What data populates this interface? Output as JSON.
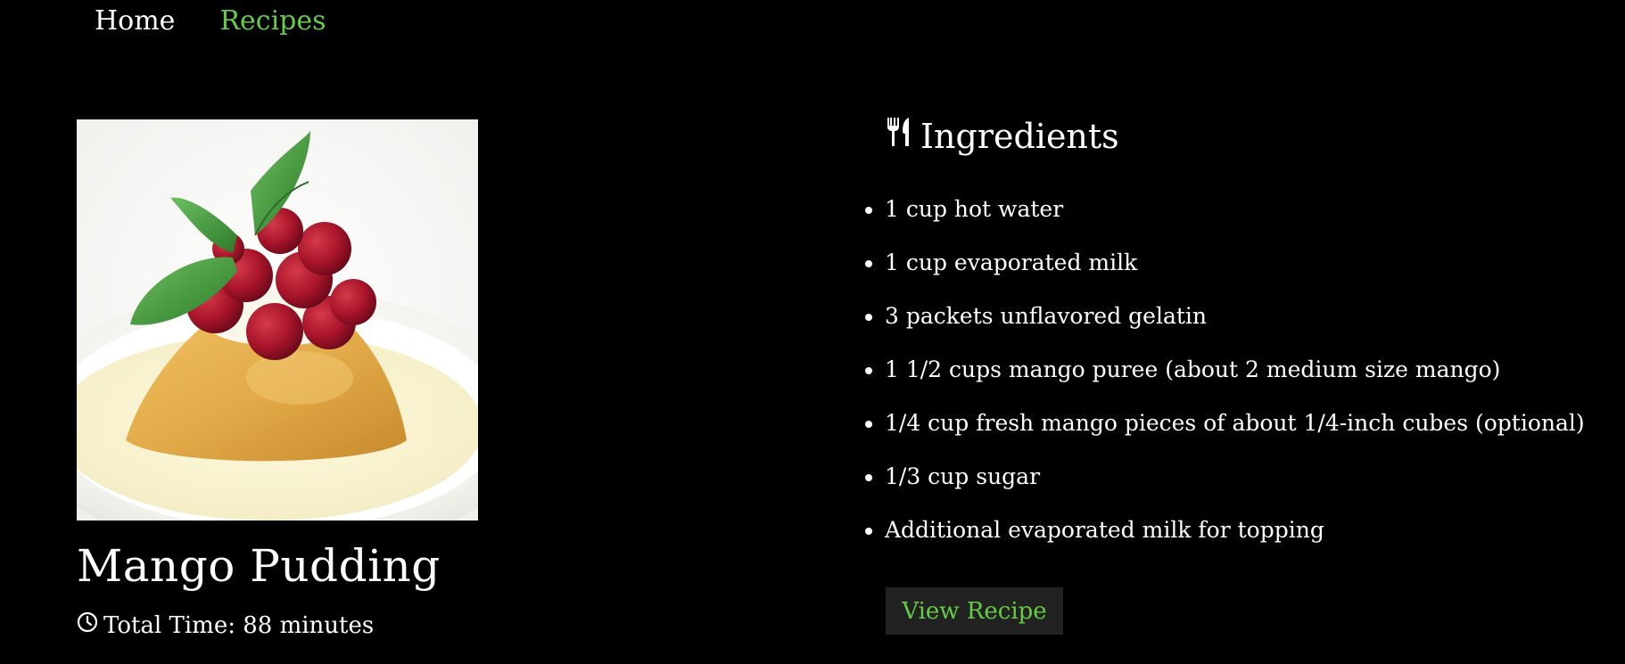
{
  "nav": {
    "home_label": "Home",
    "recipes_label": "Recipes"
  },
  "recipe": {
    "title": "Mango Pudding",
    "total_time_label": "Total Time: 88 minutes",
    "image_description_icon": "mango-pudding-photo"
  },
  "ingredients": {
    "heading": "Ingredients",
    "heading_icon": "utensils-icon",
    "items": [
      "1 cup hot water",
      "1 cup evaporated milk",
      "3 packets unflavored gelatin",
      "1 1/2 cups mango puree (about 2 medium size mango)",
      "1/4 cup fresh mango pieces of about 1/4-inch cubes (optional)",
      "1/3 cup sugar",
      "Additional evaporated milk for topping"
    ]
  },
  "actions": {
    "view_recipe_label": "View Recipe"
  },
  "colors": {
    "background": "#000000",
    "text": "#ffffff",
    "accent": "#66cc44",
    "button_bg": "#222222"
  }
}
